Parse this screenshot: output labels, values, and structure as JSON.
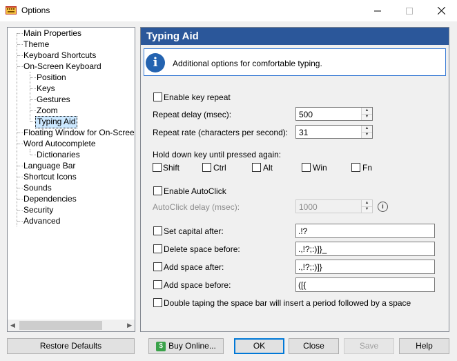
{
  "window": {
    "title": "Options"
  },
  "tree": {
    "items": [
      {
        "label": "Main Properties"
      },
      {
        "label": "Theme"
      },
      {
        "label": "Keyboard Shortcuts"
      },
      {
        "label": "On-Screen Keyboard"
      },
      {
        "label": "Position"
      },
      {
        "label": "Keys"
      },
      {
        "label": "Gestures"
      },
      {
        "label": "Zoom"
      },
      {
        "label": "Typing Aid"
      },
      {
        "label": "Floating Window for On-Screen Keyboard"
      },
      {
        "label": "Word Autocomplete"
      },
      {
        "label": "Dictionaries"
      },
      {
        "label": "Language Bar"
      },
      {
        "label": "Shortcut Icons"
      },
      {
        "label": "Sounds"
      },
      {
        "label": "Dependencies"
      },
      {
        "label": "Security"
      },
      {
        "label": "Advanced"
      }
    ],
    "selected": "Typing Aid"
  },
  "panel": {
    "title": "Typing Aid",
    "info": "Additional options for comfortable typing.",
    "enable_key_repeat": {
      "label": "Enable key repeat",
      "checked": false
    },
    "repeat_delay": {
      "label": "Repeat delay (msec):",
      "value": "500"
    },
    "repeat_rate": {
      "label": "Repeat rate (characters per second):",
      "value": "31"
    },
    "hold_down_label": "Hold down key until pressed again:",
    "modifiers": [
      {
        "label": "Shift",
        "checked": false
      },
      {
        "label": "Ctrl",
        "checked": false
      },
      {
        "label": "Alt",
        "checked": false
      },
      {
        "label": "Win",
        "checked": false
      },
      {
        "label": "Fn",
        "checked": false
      }
    ],
    "enable_autoclick": {
      "label": "Enable AutoClick",
      "checked": false
    },
    "autoclick_delay": {
      "label": "AutoClick delay (msec):",
      "value": "1000"
    },
    "set_capital_after": {
      "label": "Set capital after:",
      "value": ".!?"
    },
    "delete_space_before": {
      "label": "Delete space before:",
      "value": ".,!?;:)]}_"
    },
    "add_space_after": {
      "label": "Add space after:",
      "value": ".,!?;:)]}"
    },
    "add_space_before": {
      "label": "Add space before:",
      "value": "([{"
    },
    "double_tap": {
      "label": "Double taping the space bar will insert a period followed by a space"
    }
  },
  "buttons": {
    "restore": "Restore Defaults",
    "buy": "Buy Online...",
    "ok": "OK",
    "close": "Close",
    "save": "Save",
    "help": "Help"
  },
  "colors": {
    "header": "#2b579a",
    "selection": "#cce8ff",
    "accent": "#0078d7"
  }
}
